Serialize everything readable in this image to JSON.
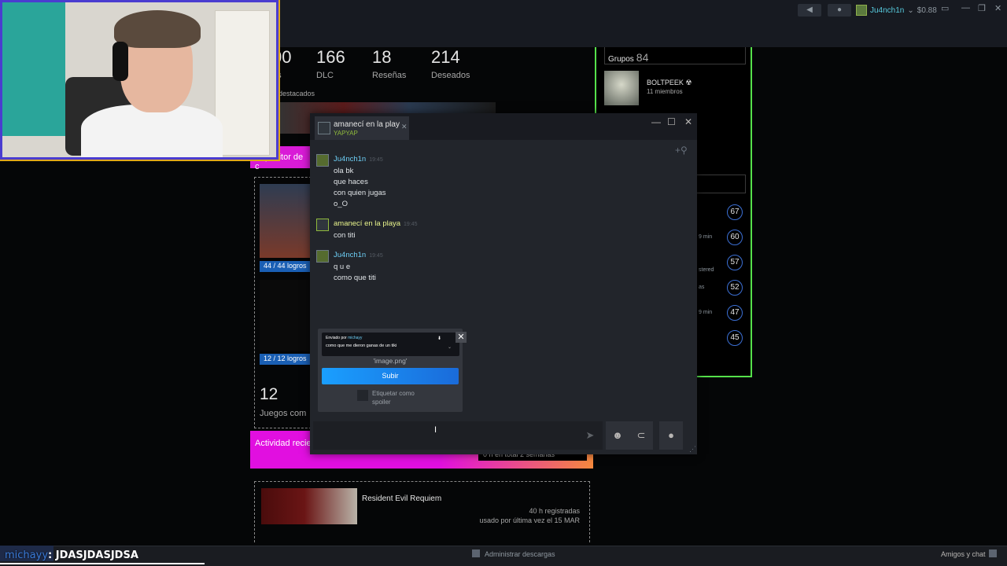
{
  "topbar": {
    "user_name": "Ju4nch1n",
    "balance": "$0.88"
  },
  "profile": {
    "stats": [
      {
        "num": "00",
        "label": "os"
      },
      {
        "num": "166",
        "label": "DLC"
      },
      {
        "num": "18",
        "label": "Reseñas"
      },
      {
        "num": "214",
        "label": "Deseados"
      }
    ],
    "featured_label": "destacados",
    "showcase_title": "Expositor de c",
    "showcase_items": [
      {
        "achievements": "44 / 44 logros"
      },
      {
        "achievements": "12 / 12 logros"
      }
    ],
    "games_count": "12",
    "games_label": "Juegos com",
    "activity_title": "Actividad recie",
    "activity_week": "0 h en total 2 semanas",
    "recent_game": {
      "title": "Resident Evil Requiem",
      "hours": "40 h registradas",
      "last_played": "usado por última vez el 15 MAR"
    }
  },
  "right_column": {
    "groups_label": "Grupos",
    "groups_count": "84",
    "group": {
      "name": "BOLTPEEK ☢",
      "members": "11 miembros"
    },
    "levels": [
      "67",
      "60",
      "57",
      "52",
      "47",
      "45"
    ],
    "level_notes": [
      "9 min",
      "stered",
      "as",
      "9 min"
    ]
  },
  "chat": {
    "tab_name": "amanecí en la playa",
    "tab_game": "YAPYAP",
    "messages": [
      {
        "author": "Ju4nch1n",
        "friend": false,
        "time": "19:45",
        "lines": [
          "ola bk",
          "que haces",
          "con quien jugas",
          "o_O"
        ]
      },
      {
        "author": "amanecí en la playa",
        "friend": true,
        "time": "19:45",
        "lines": [
          "con titi"
        ]
      },
      {
        "author": "Ju4nch1n",
        "friend": false,
        "time": "19:45",
        "lines": [
          "q u e",
          "como que titi"
        ]
      }
    ],
    "upload": {
      "sent_by": "Enviado por",
      "sent_by_user": "michayy",
      "preview_text": "como que me dieron ganas de un tiki",
      "filename": "'image.png'",
      "button": "Subir",
      "spoiler_label": "Etiquetar como spoiler"
    }
  },
  "bottombar": {
    "downloads": "Administrar descargas",
    "friends": "Amigos y chat"
  },
  "overlay": {
    "user": "michayy",
    "message": ": JDASJDASJDSA"
  }
}
